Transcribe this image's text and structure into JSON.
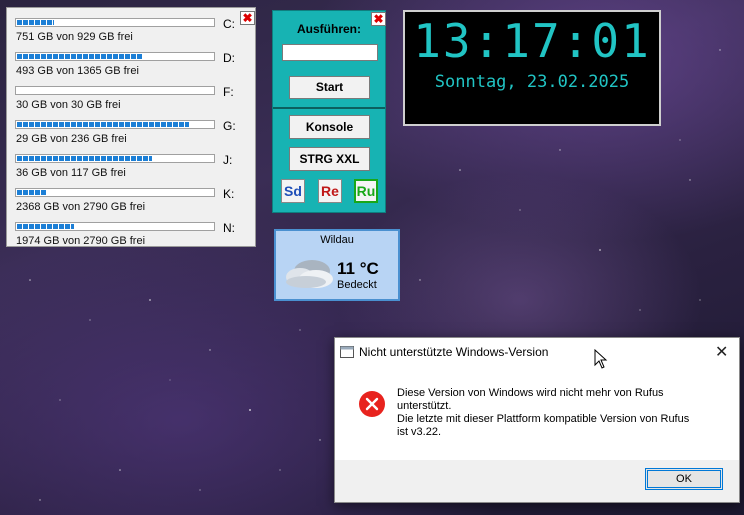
{
  "drives": {
    "items": [
      {
        "letter": "C:",
        "free_text": "751 GB von 929 GB frei",
        "used_fraction": 0.19
      },
      {
        "letter": "D:",
        "free_text": "493 GB von 1365 GB frei",
        "used_fraction": 0.64
      },
      {
        "letter": "F:",
        "free_text": "30 GB von 30 GB frei",
        "used_fraction": 0.0
      },
      {
        "letter": "G:",
        "free_text": "29 GB von 236 GB frei",
        "used_fraction": 0.88
      },
      {
        "letter": "J:",
        "free_text": "36 GB von 117 GB frei",
        "used_fraction": 0.69
      },
      {
        "letter": "K:",
        "free_text": "2368 GB von 2790 GB frei",
        "used_fraction": 0.15
      },
      {
        "letter": "N:",
        "free_text": "1974 GB von 2790 GB frei",
        "used_fraction": 0.29
      }
    ]
  },
  "run_widget": {
    "title": "Ausführen:",
    "input_value": "",
    "start_label": "Start",
    "console_label": "Konsole",
    "strg_label": "STRG XXL",
    "shortcuts": [
      {
        "label": "Sd",
        "color": "#1f4fb8"
      },
      {
        "label": "Re",
        "color": "#c01818"
      },
      {
        "label": "Ru",
        "color": "#18a818"
      }
    ]
  },
  "clock": {
    "time": "13:17:01",
    "date": "Sonntag, 23.02.2025",
    "color": "#21c4c4"
  },
  "weather": {
    "city": "Wildau",
    "temperature": "11 °C",
    "condition": "Bedeckt",
    "icon": "cloud-icon"
  },
  "dialog": {
    "title": "Nicht unterstützte Windows-Version",
    "message_lines": [
      "Diese Version von Windows wird nicht mehr von Rufus",
      "unterstützt.",
      "Die letzte mit dieser Plattform kompatible Version von Rufus",
      "ist v3.22."
    ],
    "ok_label": "OK",
    "icon": "error-icon"
  },
  "colors": {
    "accent_teal": "#17b3b3",
    "drive_bar": "#1c7fd6",
    "error_red": "#e8231e"
  }
}
